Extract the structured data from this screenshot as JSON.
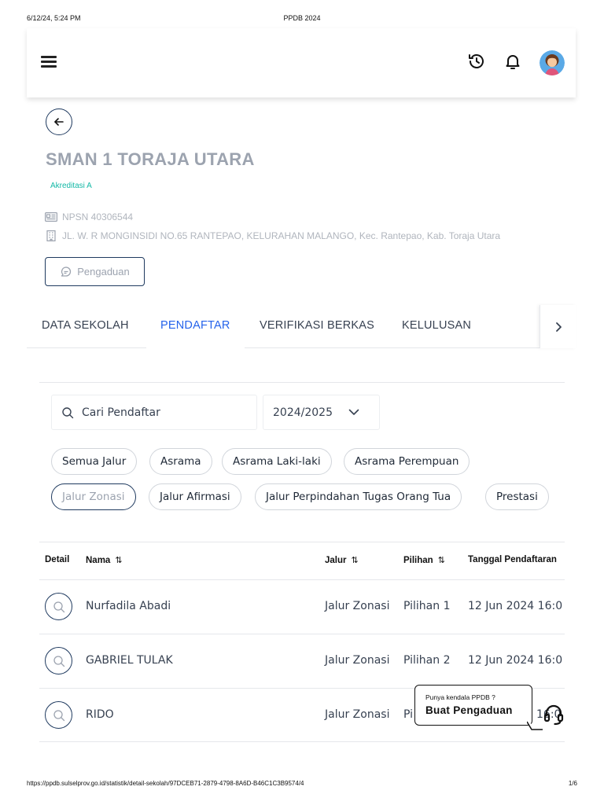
{
  "print_header": {
    "datetime": "6/12/24, 5:24 PM",
    "title": "PPDB 2024"
  },
  "print_footer": {
    "url": "https://ppdb.sulselprov.go.id/statistik/detail-sekolah/97DCEB71-2879-4798-8A6D-B46C1C3B9574/4",
    "page": "1/6"
  },
  "topbar": {
    "icons": [
      "menu-icon",
      "history-icon",
      "bell-icon",
      "avatar"
    ]
  },
  "school": {
    "name": "SMAN 1 TORAJA UTARA",
    "accreditation": "Akreditasi A",
    "npsn": "NPSN 40306544",
    "address": "JL. W. R MONGINSIDI NO.65 RANTEPAO, KELURAHAN MALANGO, Kec. Rantepao, Kab. Toraja Utara",
    "complaint_button": "Pengaduan"
  },
  "tabs": [
    {
      "label": "DATA SEKOLAH",
      "active": false
    },
    {
      "label": "PENDAFTAR",
      "active": true
    },
    {
      "label": "VERIFIKASI BERKAS",
      "active": false
    },
    {
      "label": "KELULUSAN",
      "active": false
    }
  ],
  "filters": {
    "search_placeholder": "Cari Pendaftar",
    "year_selected": "2024/2025",
    "chips": [
      {
        "label": "Semua Jalur",
        "active": false
      },
      {
        "label": "Asrama",
        "active": false
      },
      {
        "label": "Asrama Laki-laki",
        "active": false
      },
      {
        "label": "Asrama Perempuan",
        "active": false
      },
      {
        "label": "Jalur Zonasi",
        "active": true
      },
      {
        "label": "Jalur Afirmasi",
        "active": false
      },
      {
        "label": "Jalur Perpindahan Tugas Orang Tua",
        "active": false
      },
      {
        "label": "Prestasi",
        "active": false
      }
    ]
  },
  "table": {
    "headers": {
      "detail": "Detail",
      "nama": "Nama",
      "jalur": "Jalur",
      "pilihan": "Pilihan",
      "tanggal": "Tanggal Pendaftaran",
      "sort_glyph": "⇅"
    },
    "rows": [
      {
        "nama": "Nurfadila Abadi",
        "jalur": "Jalur Zonasi",
        "pilihan": "Pilihan 1",
        "tanggal": "12 Jun 2024 16:0"
      },
      {
        "nama": "GABRIEL TULAK",
        "jalur": "Jalur Zonasi",
        "pilihan": "Pilihan 2",
        "tanggal": "12 Jun 2024 16:0"
      },
      {
        "nama": "RIDO",
        "jalur": "Jalur Zonasi",
        "pilihan": "Pi",
        "tanggal": "16:0"
      }
    ]
  },
  "help": {
    "small": "Punya kendala PPDB ?",
    "big": "Buat Pengaduan"
  },
  "colors": {
    "active_tab": "#2563eb",
    "accreditation": "#14b8a6",
    "outline_navy": "#1f3a5f"
  }
}
